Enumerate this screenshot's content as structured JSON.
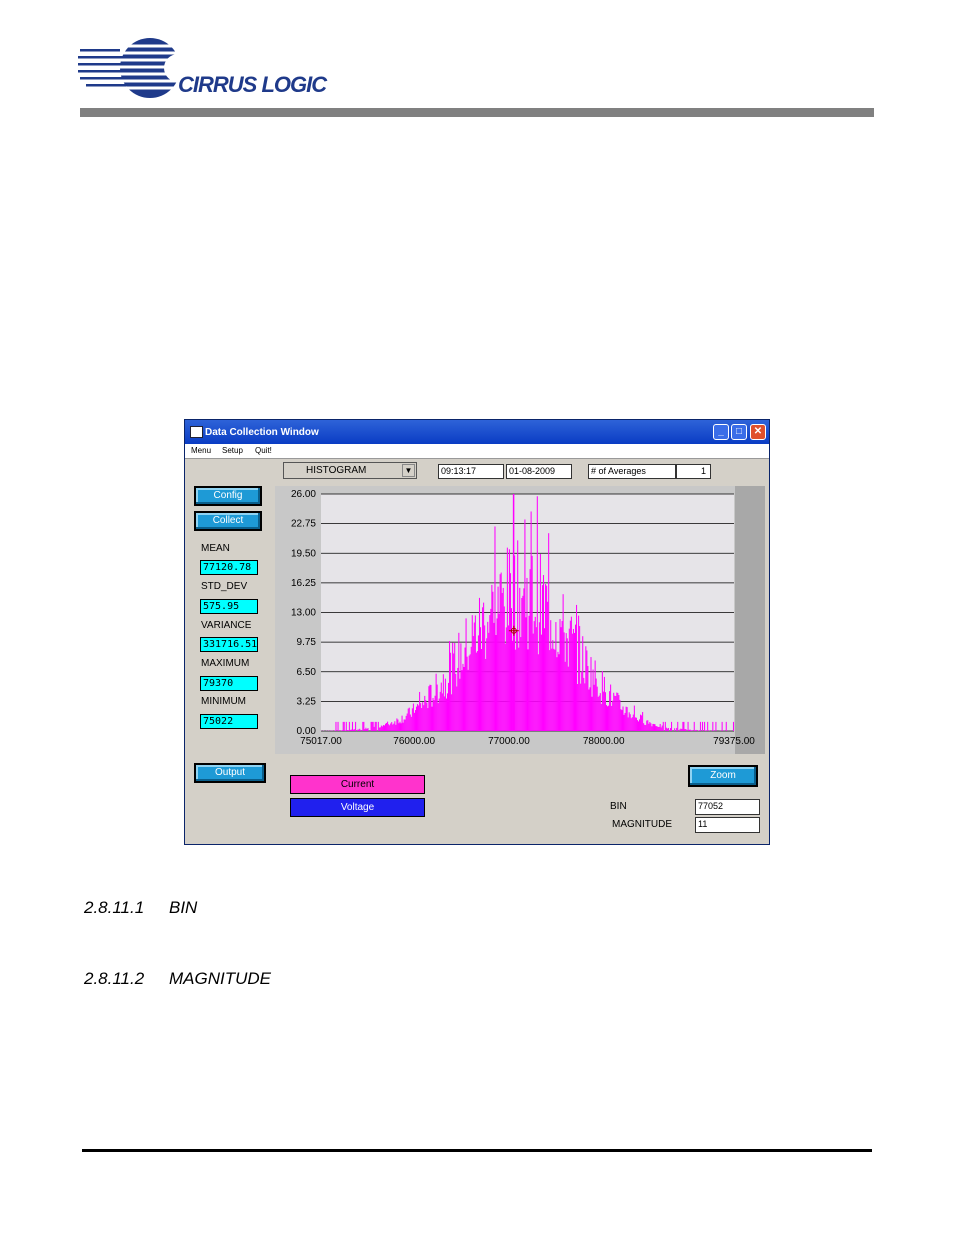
{
  "header": {
    "logo_text": "CIRRUS LOGIC",
    "logo_color": "#1f3a8a"
  },
  "window": {
    "title": "Data Collection Window",
    "menu": [
      "Menu",
      "Setup",
      "Quit!"
    ],
    "mode_select": "HISTOGRAM",
    "time": "09:13:17",
    "date": "01-08-2009",
    "averages_label": "# of Averages",
    "averages_value": "1",
    "buttons": {
      "config": "Config",
      "collect": "Collect",
      "output": "Output",
      "zoom": "Zoom"
    },
    "stats": [
      {
        "label": "MEAN",
        "value": "77120.78"
      },
      {
        "label": "STD_DEV",
        "value": "575.95"
      },
      {
        "label": "VARIANCE",
        "value": "331716.51"
      },
      {
        "label": "MAXIMUM",
        "value": "79370"
      },
      {
        "label": "MINIMUM",
        "value": "75022"
      }
    ],
    "channels": {
      "current": "Current",
      "voltage": "Voltage"
    },
    "channel_colors": {
      "current": "#ff00ff",
      "voltage": "#1a1aff"
    },
    "bin_label": "BIN",
    "bin_value": "77052",
    "magnitude_label": "MAGNITUDE",
    "magnitude_value": "11",
    "accent": "#1e9ad6",
    "stat_bg": "#00ffff"
  },
  "chart_data": {
    "type": "bar",
    "series_color": "#ff00ff",
    "xlim": [
      75017.0,
      79375.0
    ],
    "ylim": [
      0,
      26.0
    ],
    "y_ticks": [
      "26.00",
      "22.75",
      "19.50",
      "16.25",
      "13.00",
      "9.75",
      "6.50",
      "3.25",
      "0.00"
    ],
    "x_ticks": [
      "75017.00",
      "76000.00",
      "77000.00",
      "78000.00",
      "79375.00"
    ],
    "distribution": {
      "mean": 77120.78,
      "std_dev": 575.95,
      "peak": 26,
      "min": 75022,
      "max": 79370
    },
    "grid": true,
    "cursor": {
      "x": 77052,
      "y": 11
    }
  },
  "sections": [
    {
      "number": "2.8.11.1",
      "title": "BIN"
    },
    {
      "number": "2.8.11.2",
      "title": "MAGNITUDE"
    }
  ]
}
